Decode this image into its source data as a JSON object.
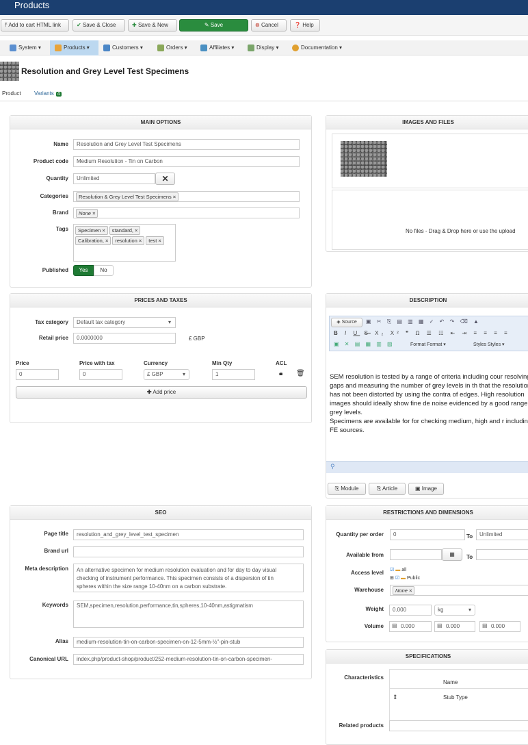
{
  "app": {
    "title": "Products"
  },
  "toolbar": {
    "add_to_cart": "Add to cart HTML link",
    "save_close": "Save & Close",
    "save_new": "Save & New",
    "save": "Save",
    "cancel": "Cancel",
    "help": "Help"
  },
  "menu": {
    "items": [
      "System",
      "Products",
      "Customers",
      "Orders",
      "Affiliates",
      "Display",
      "Documentation"
    ]
  },
  "page": {
    "title": "Resolution and Grey Level Test Specimens"
  },
  "tabs": {
    "product": "Product",
    "variants": "Variants",
    "variants_count": "4"
  },
  "main_options": {
    "heading": "MAIN OPTIONS",
    "name_label": "Name",
    "name_value": "Resolution and Grey Level Test Specimens",
    "code_label": "Product code",
    "code_value": "Medium Resolution - Tin on Carbon",
    "qty_label": "Quantity",
    "qty_value": "Unlimited",
    "cat_label": "Categories",
    "cat_value": "Resolution & Grey Level Test Specimens",
    "brand_label": "Brand",
    "brand_value": "None",
    "tags_label": "Tags",
    "tags": [
      "Specimen",
      "standard,",
      "Calibration,",
      "resolution",
      "test"
    ],
    "published_label": "Published",
    "yes": "Yes",
    "no": "No"
  },
  "images": {
    "heading": "IMAGES AND FILES",
    "dropzone": "No files - Drag & Drop here or use the upload"
  },
  "prices": {
    "heading": "PRICES AND TAXES",
    "tax_label": "Tax category",
    "tax_value": "Default tax category",
    "retail_label": "Retail price",
    "retail_value": "0.0000000",
    "retail_currency": "£ GBP",
    "col_price": "Price",
    "col_price_tax": "Price with tax",
    "col_currency": "Currency",
    "col_minqty": "Min Qty",
    "col_acl": "ACL",
    "price_value": "0",
    "price_tax_value": "0",
    "currency_value": "£ GBP",
    "minqty_value": "1",
    "add_price": "Add price"
  },
  "description": {
    "heading": "DESCRIPTION",
    "source": "Source",
    "format_label": "Format",
    "format_value": "Format",
    "styles_label": "Styles",
    "styles_value": "Styles",
    "text1": "SEM resolution is tested by a range of criteria including cour resolving gaps and measuring the number of grey levels in th that the resolution has not been distorted by using the contra of edges. High resolution images should ideally show fine de noise evidenced by a good range of grey levels.",
    "text2": "Specimens are available for for checking medium, high and r including FE sources.",
    "btn_module": "Module",
    "btn_article": "Article",
    "btn_image": "Image"
  },
  "seo": {
    "heading": "SEO",
    "page_title_label": "Page title",
    "page_title_value": "resolution_and_grey_level_test_specimen",
    "brand_url_label": "Brand url",
    "meta_label": "Meta description",
    "meta_value": "An alternative specimen for medium resolution evaluation and for day to day visual checking of instrument performance. This specimen consists of a dispersion of tin spheres within the size range 10-40nm on a carbon substrate.",
    "keywords_label": "Keywords",
    "keywords_value": "SEM,specimen,resolution,performance,tin,spheres,10-40nm,astigmatism",
    "alias_label": "Alias",
    "alias_value": "medium-resolution-tin-on-carbon-specimen-on-12-5mm-½\"-pin-stub",
    "canonical_label": "Canonical URL",
    "canonical_value": "index.php/product-shop/product/252-medium-resolution-tin-on-carbon-specimen-"
  },
  "restrictions": {
    "heading": "RESTRICTIONS AND DIMENSIONS",
    "qpo_label": "Quantity per order",
    "qpo_from": "0",
    "to": "To",
    "qpo_to": "Unlimited",
    "available_label": "Available from",
    "access_label": "Access level",
    "access_all": "all",
    "access_public": "Public",
    "warehouse_label": "Warehouse",
    "warehouse_value": "None",
    "weight_label": "Weight",
    "weight_value": "0.000",
    "weight_unit": "kg",
    "volume_label": "Volume",
    "vol1": "0.000",
    "vol2": "0.000",
    "vol3": "0.000"
  },
  "specifications": {
    "heading": "SPECIFICATIONS",
    "char_label": "Characteristics",
    "col_name": "Name",
    "row1": "Stub Type",
    "related_label": "Related products"
  }
}
